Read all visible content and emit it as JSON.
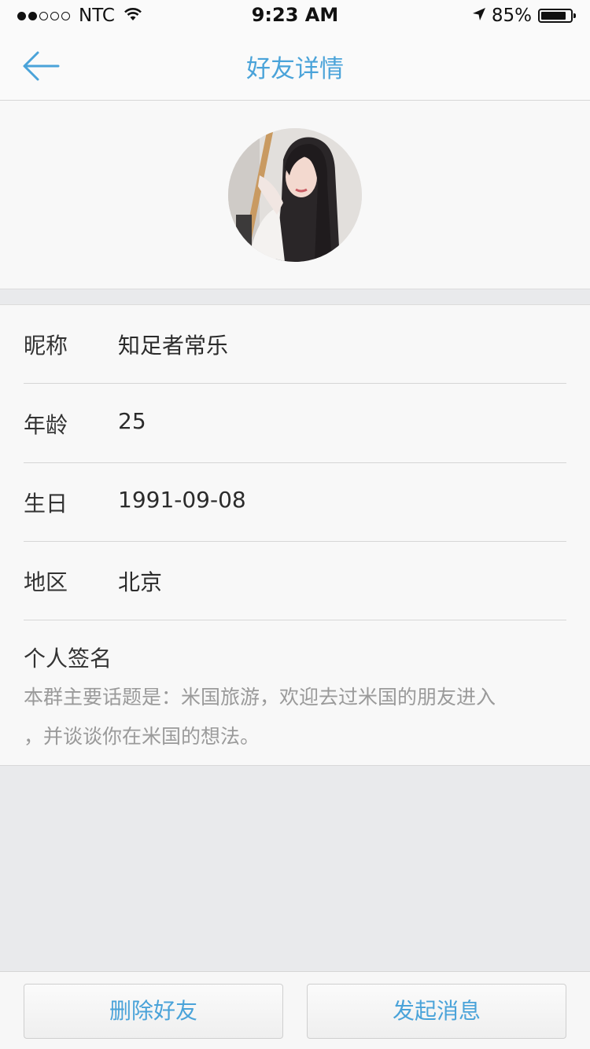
{
  "status_bar": {
    "carrier": "NTC",
    "time": "9:23 AM",
    "battery": "85%",
    "signal_bars_filled": 2,
    "signal_bars_total": 5,
    "battery_level": 0.85
  },
  "nav": {
    "title": "好友详情",
    "back_icon": "arrow-left-icon"
  },
  "profile": {
    "avatar": "avatar-photo",
    "rows": [
      {
        "label": "昵称",
        "value": "知足者常乐"
      },
      {
        "label": "年龄",
        "value": "25"
      },
      {
        "label": "生日",
        "value": "1991-09-08"
      },
      {
        "label": "地区",
        "value": "北京"
      }
    ],
    "signature_label": "个人签名",
    "signature_line1": "本群主要话题是：米国旅游，欢迎去过米国的朋友进入",
    "signature_line2": "，并谈谈你在米国的想法。"
  },
  "actions": {
    "delete_label": "删除好友",
    "message_label": "发起消息"
  },
  "colors": {
    "accent": "#4aa3d9",
    "background": "#e9eaec",
    "card": "#f8f8f8",
    "muted_text": "#9a9a9a"
  }
}
